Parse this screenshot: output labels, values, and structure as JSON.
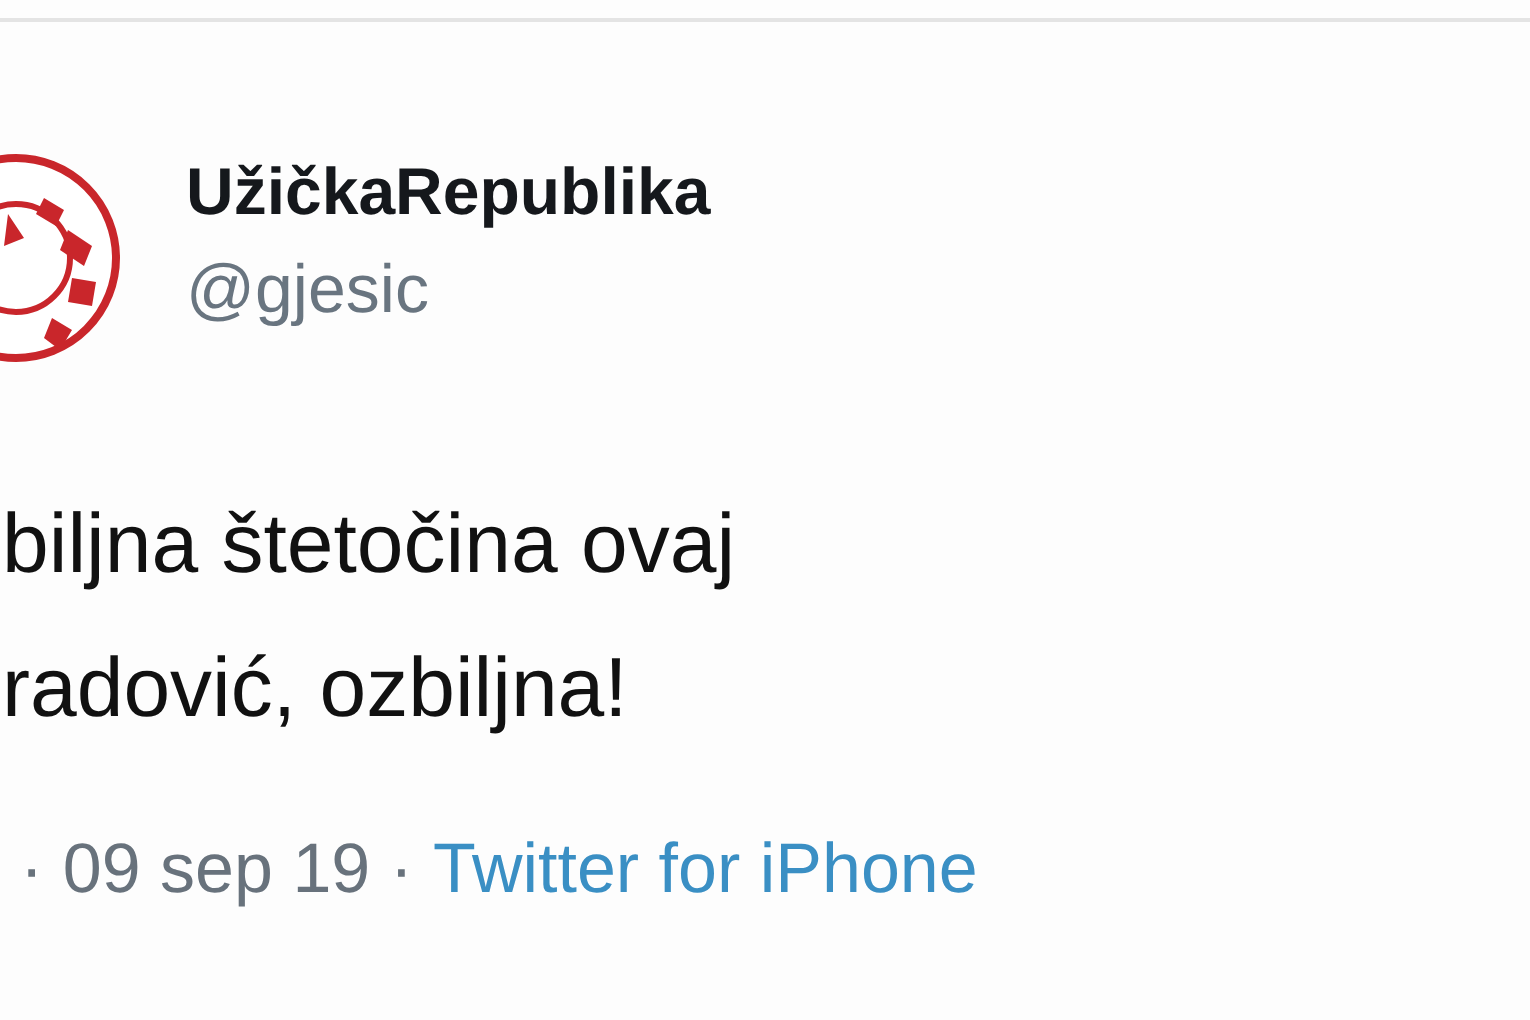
{
  "tweet": {
    "author": {
      "name": "UžičkaRepublika",
      "handle": "@gjesic"
    },
    "text_lines": [
      "biljna štetočina ovaj",
      "radović, ozbiljna!"
    ],
    "meta": {
      "date": "· 09 sep 19 ·",
      "source": "Twitter for iPhone"
    }
  }
}
